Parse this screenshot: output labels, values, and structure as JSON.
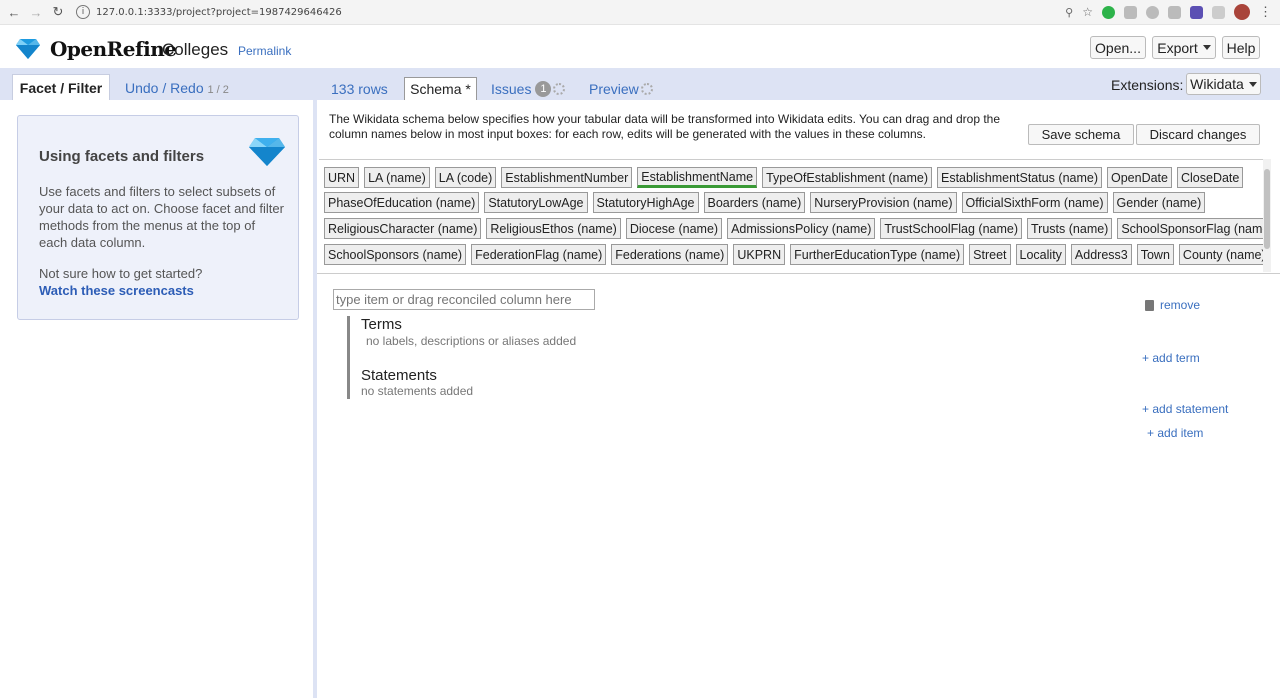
{
  "browser": {
    "url": "127.0.0.1:3333/project?project=1987429646426"
  },
  "header": {
    "app_name": "OpenRefine",
    "project_name": "Colleges",
    "permalink": "Permalink",
    "buttons": {
      "open": "Open...",
      "export": "Export",
      "help": "Help"
    }
  },
  "left_panel": {
    "tabs": {
      "facet_filter": "Facet / Filter",
      "undo_redo": "Undo / Redo",
      "undo_count": "1 / 2"
    },
    "help": {
      "title": "Using facets and filters",
      "text": "Use facets and filters to select subsets of your data to act on. Choose facet and filter methods from the menus at the top of each data column.",
      "question": "Not sure how to get started?",
      "link": "Watch these screencasts"
    }
  },
  "right_panel": {
    "tabs": {
      "rows": "133 rows",
      "schema": "Schema *",
      "issues": "Issues",
      "issues_count": "1",
      "preview": "Preview"
    },
    "extensions_label": "Extensions:",
    "extensions_value": "Wikidata",
    "description": "The Wikidata schema below specifies how your tabular data will be transformed into Wikidata edits. You can drag and drop the column names below in most input boxes: for each row, edits will be generated with the values in these columns.",
    "save_schema": "Save schema",
    "discard_changes": "Discard changes",
    "columns": [
      [
        "URN",
        "LA (name)",
        "LA (code)",
        "EstablishmentNumber",
        "EstablishmentName",
        "TypeOfEstablishment (name)",
        "EstablishmentStatus (name)",
        "OpenDate",
        "CloseDate"
      ],
      [
        "PhaseOfEducation (name)",
        "StatutoryLowAge",
        "StatutoryHighAge",
        "Boarders (name)",
        "NurseryProvision (name)",
        "OfficialSixthForm (name)",
        "Gender (name)"
      ],
      [
        "ReligiousCharacter (name)",
        "ReligiousEthos (name)",
        "Diocese (name)",
        "AdmissionsPolicy (name)",
        "TrustSchoolFlag (name)",
        "Trusts (name)",
        "SchoolSponsorFlag (name)"
      ],
      [
        "SchoolSponsors (name)",
        "FederationFlag (name)",
        "Federations (name)",
        "UKPRN",
        "FurtherEducationType (name)",
        "Street",
        "Locality",
        "Address3",
        "Town",
        "County (name)"
      ]
    ],
    "item_input_placeholder": "type item or drag reconciled column here",
    "remove": "remove",
    "terms_title": "Terms",
    "terms_note": "no labels, descriptions or aliases added",
    "add_term": "+ add term",
    "statements_title": "Statements",
    "statements_note": "no statements added",
    "add_statement": "+ add statement",
    "add_item": "+ add item"
  }
}
